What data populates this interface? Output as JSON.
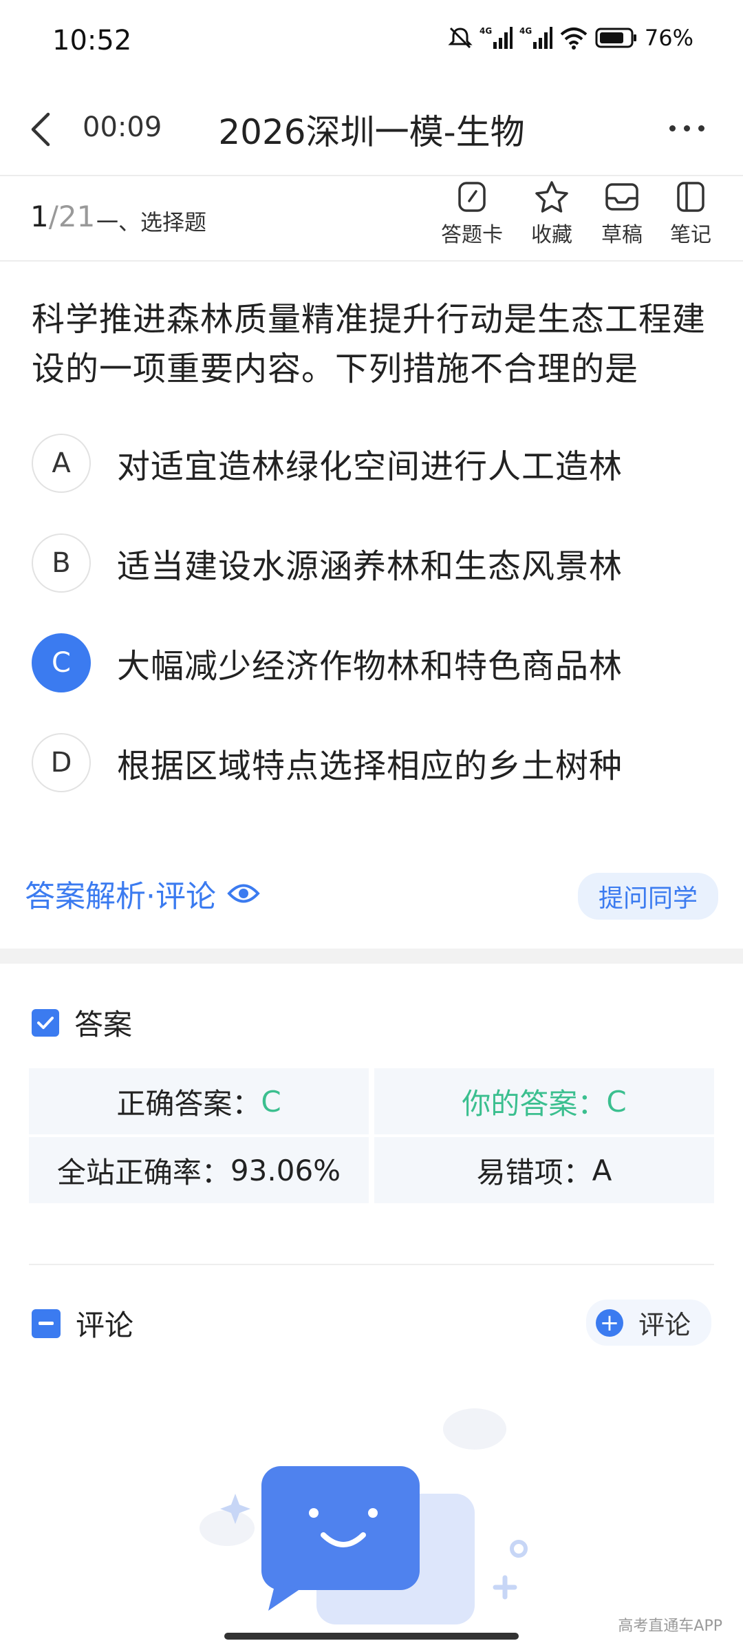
{
  "status_bar": {
    "time": "10:52",
    "battery": "76%"
  },
  "title_bar": {
    "timer": "00:09",
    "title": "2026深圳一模-生物"
  },
  "toolbar": {
    "current": "1",
    "total": "/21",
    "section": "一、选择题",
    "tools": [
      {
        "label": "答题卡",
        "icon": "answer-card-icon"
      },
      {
        "label": "收藏",
        "icon": "star-icon"
      },
      {
        "label": "草稿",
        "icon": "draft-icon"
      },
      {
        "label": "笔记",
        "icon": "notebook-icon"
      }
    ]
  },
  "question": {
    "text": "科学推进森林质量精准提升行动是生态工程建设的一项重要内容。下列措施不合理的是",
    "options": [
      {
        "letter": "A",
        "text": "对适宜造林绿化空间进行人工造林",
        "selected": false
      },
      {
        "letter": "B",
        "text": "适当建设水源涵养林和生态风景林",
        "selected": false
      },
      {
        "letter": "C",
        "text": "大幅减少经济作物林和特色商品林",
        "selected": true
      },
      {
        "letter": "D",
        "text": "根据区域特点选择相应的乡土树种",
        "selected": false
      }
    ]
  },
  "analysis": {
    "label": "答案解析·评论",
    "ask_button": "提问同学"
  },
  "answer": {
    "heading": "答案",
    "correct_label": "正确答案：",
    "correct_value": "C",
    "your_label": "你的答案：",
    "your_value": "C",
    "rate_label": "全站正确率：",
    "rate_value": "93.06%",
    "error_label": "易错项：",
    "error_value": "A"
  },
  "comments": {
    "heading": "评论",
    "button": "评论"
  },
  "watermark": "高考直通车APP",
  "colors": {
    "accent": "#3b7bf0",
    "correct": "#3bbf8f",
    "cell_bg": "#f4f7fb"
  }
}
